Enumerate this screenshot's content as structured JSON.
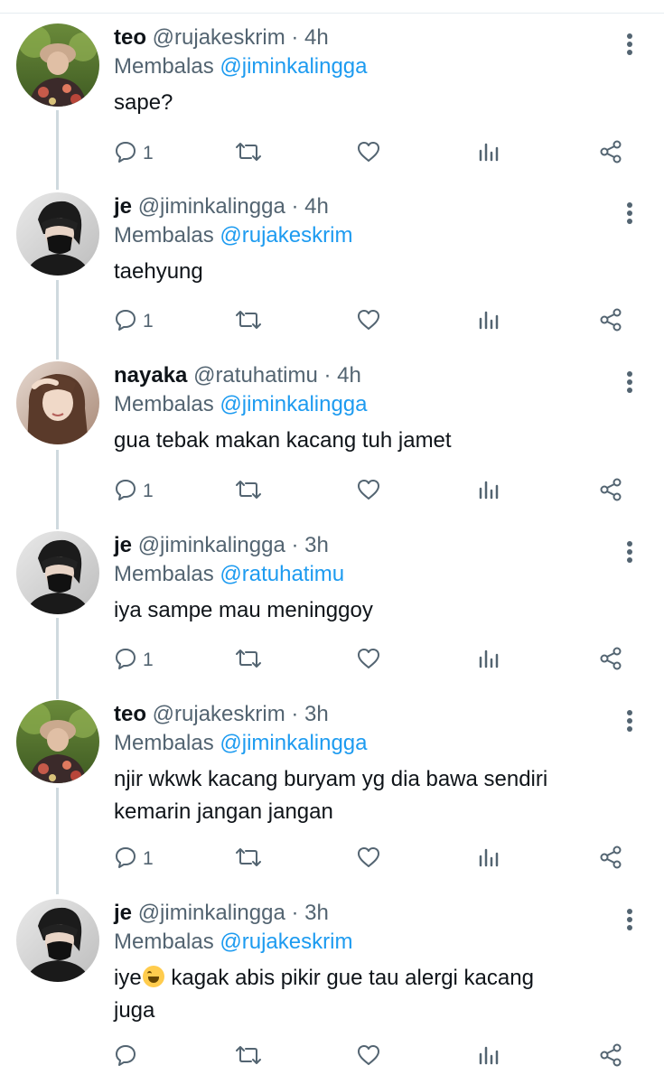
{
  "tweets": [
    {
      "name": "teo",
      "handle": "@rujakeskrim",
      "time": "· 4h",
      "replying_prefix": "Membalas",
      "replying_to": "@jiminkalingga",
      "text": "sape?",
      "reply_count": "1",
      "avatar": "teo-avatar"
    },
    {
      "name": "je",
      "handle": "@jiminkalingga",
      "time": "· 4h",
      "replying_prefix": "Membalas",
      "replying_to": "@rujakeskrim",
      "text": "taehyung",
      "reply_count": "1",
      "avatar": "je-avatar"
    },
    {
      "name": "nayaka",
      "handle": "@ratuhatimu",
      "time": "· 4h",
      "replying_prefix": "Membalas",
      "replying_to": "@jiminkalingga",
      "text": "gua tebak makan kacang tuh jamet",
      "reply_count": "1",
      "avatar": "nayaka-avatar"
    },
    {
      "name": "je",
      "handle": "@jiminkalingga",
      "time": "· 3h",
      "replying_prefix": "Membalas",
      "replying_to": "@ratuhatimu",
      "text": "iya sampe mau meninggoy",
      "reply_count": "1",
      "avatar": "je-avatar"
    },
    {
      "name": "teo",
      "handle": "@rujakeskrim",
      "time": "· 3h",
      "replying_prefix": "Membalas",
      "replying_to": "@jiminkalingga",
      "text": "njir wkwk kacang buryam yg dia bawa sendiri\nkemarin jangan jangan",
      "reply_count": "1",
      "avatar": "teo-avatar"
    },
    {
      "name": "je",
      "handle": "@jiminkalingga",
      "time": "· 3h",
      "replying_prefix": "Membalas",
      "replying_to": "@rujakeskrim",
      "text_before_emoji": "iye",
      "emoji": "rolling-on-floor-laughing",
      "text_after_emoji": " kagak abis pikir gue tau alergi kacang\njuga",
      "reply_count": "",
      "avatar": "je-avatar"
    }
  ],
  "colors": {
    "link": "#1d9bf0",
    "muted": "#536471",
    "text": "#0f1419",
    "thread_line": "#cfd9de"
  },
  "icons": [
    "reply-icon",
    "retweet-icon",
    "like-icon",
    "analytics-icon",
    "share-icon",
    "more-options-icon"
  ]
}
